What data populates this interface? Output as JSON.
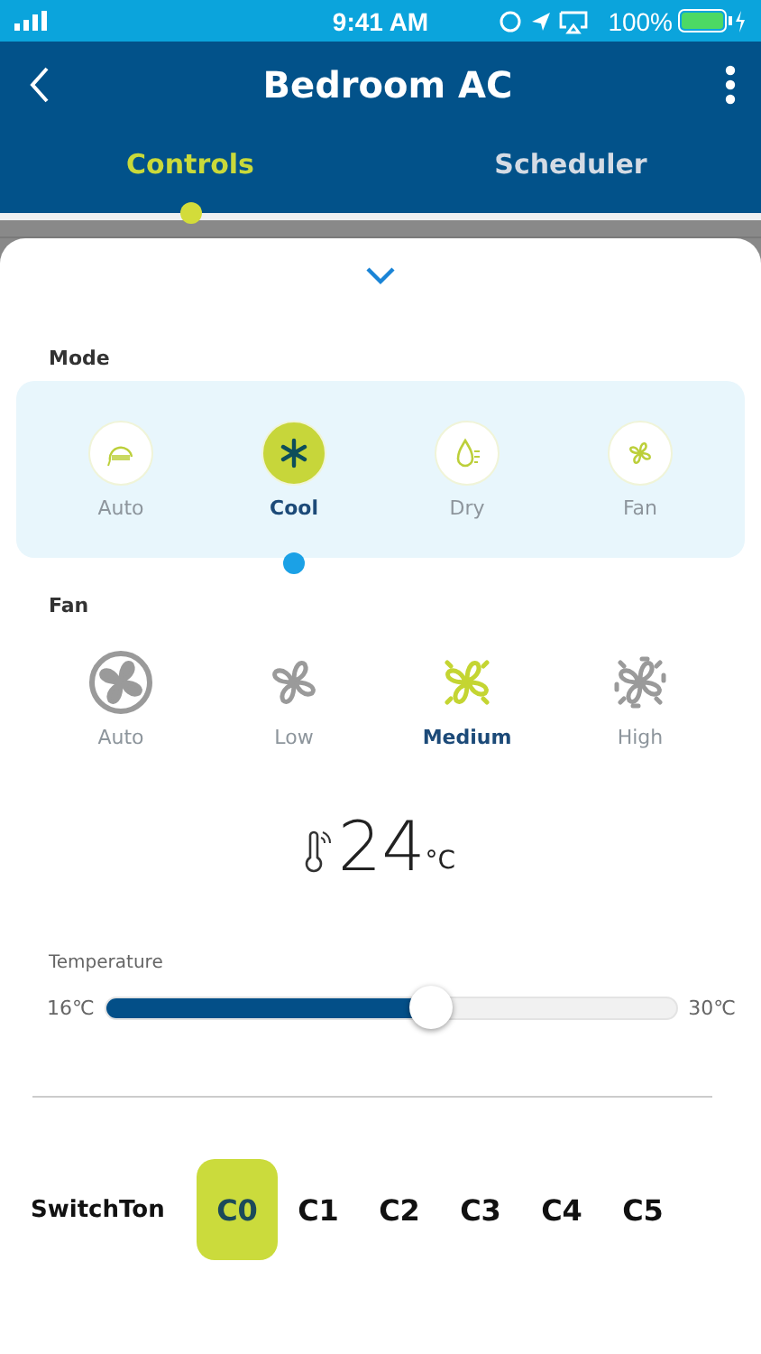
{
  "status_bar": {
    "time": "9:41 AM",
    "battery": "100%"
  },
  "header": {
    "title": "Bedroom AC"
  },
  "tabs": [
    {
      "label": "Controls",
      "selected": true
    },
    {
      "label": "Scheduler",
      "selected": false
    }
  ],
  "mode": {
    "label": "Mode",
    "options": [
      {
        "kind": "auto",
        "label": "Auto",
        "selected": false
      },
      {
        "kind": "cool",
        "label": "Cool",
        "selected": true
      },
      {
        "kind": "dry",
        "label": "Dry",
        "selected": false
      },
      {
        "kind": "fan",
        "label": "Fan",
        "selected": false
      }
    ]
  },
  "fan": {
    "label": "Fan",
    "options": [
      {
        "kind": "auto",
        "label": "Auto",
        "selected": false
      },
      {
        "kind": "low",
        "label": "Low",
        "selected": false
      },
      {
        "kind": "medium",
        "label": "Medium",
        "selected": true
      },
      {
        "kind": "high",
        "label": "High",
        "selected": false
      }
    ]
  },
  "reading": {
    "value": "24",
    "unit": "°C"
  },
  "temperature": {
    "label": "Temperature",
    "min": "16℃",
    "max": "30℃",
    "level": 0.57
  },
  "switch": {
    "label": "SwitchTon",
    "channels": [
      {
        "label": "C0",
        "selected": true
      },
      {
        "label": "C1",
        "selected": false
      },
      {
        "label": "C2",
        "selected": false
      },
      {
        "label": "C3",
        "selected": false
      },
      {
        "label": "C4",
        "selected": false
      },
      {
        "label": "C5",
        "selected": false
      }
    ]
  }
}
